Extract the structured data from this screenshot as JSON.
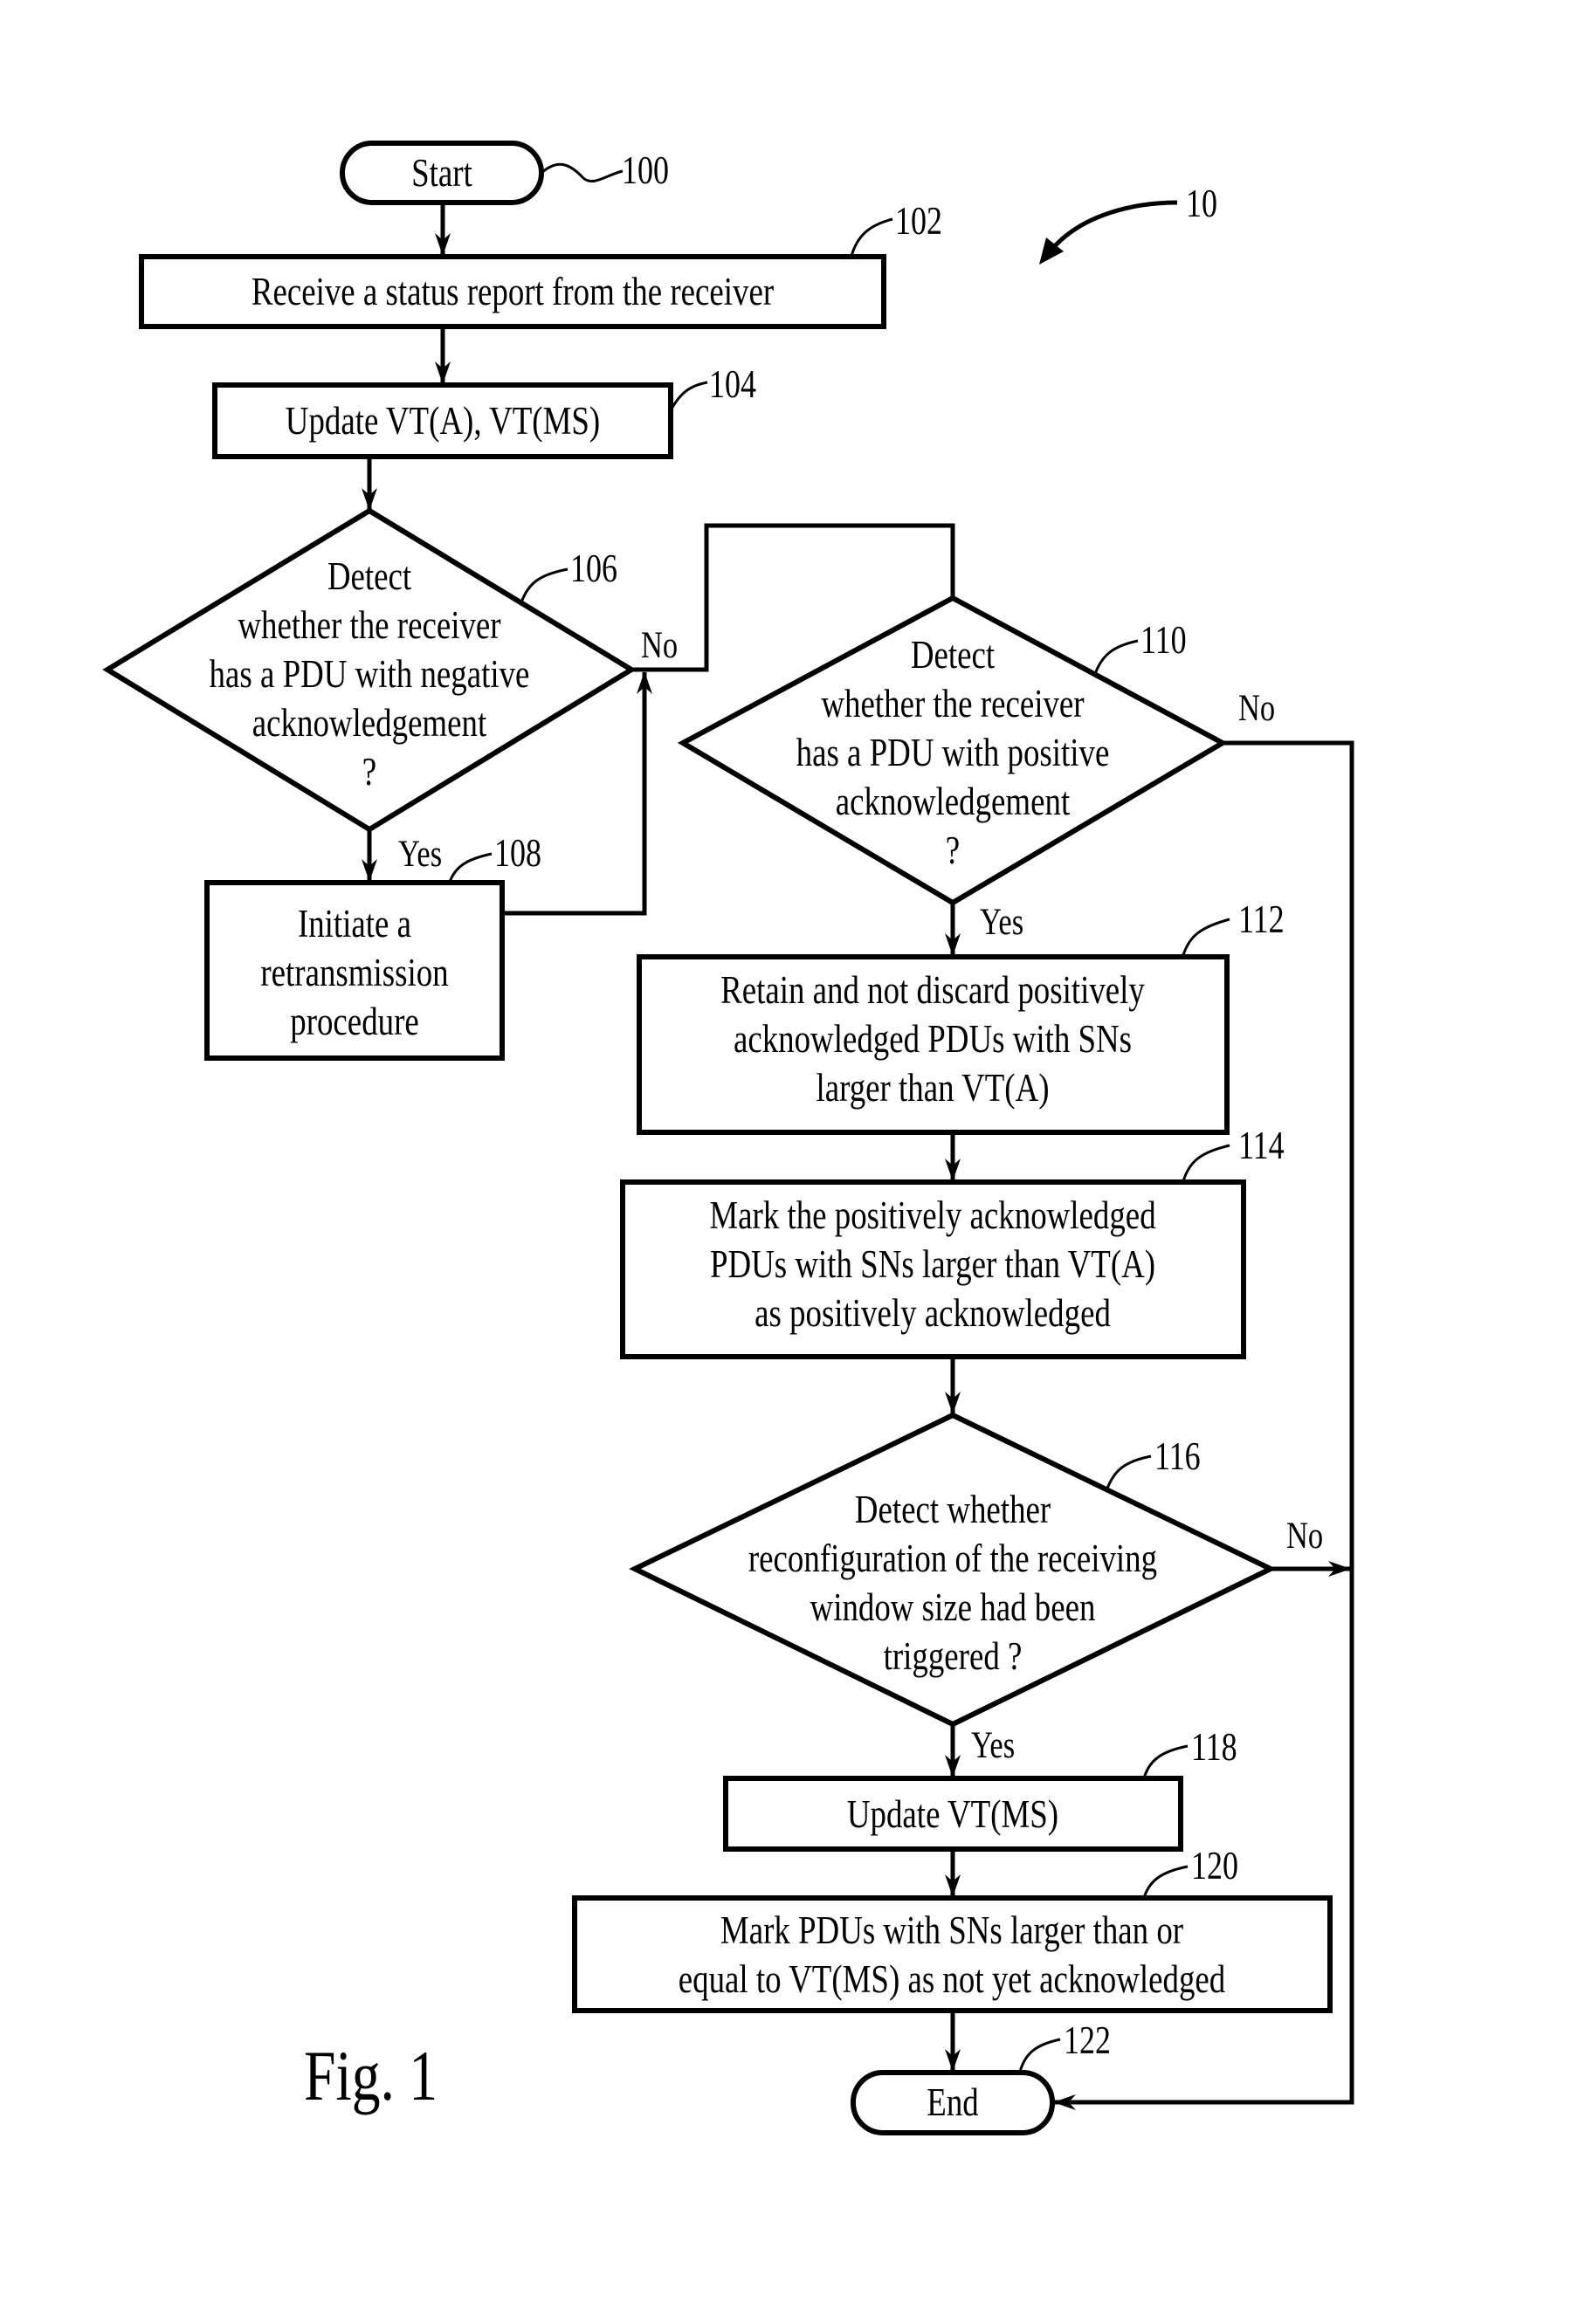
{
  "figure": {
    "label": "Fig. 1",
    "reference": "10",
    "colors": {
      "ink": "#000000",
      "paper": "#ffffff"
    }
  },
  "nodes": {
    "start": {
      "ref": "100",
      "type": "terminator",
      "lines": [
        "Start"
      ]
    },
    "n102": {
      "ref": "102",
      "type": "process",
      "lines": [
        "Receive a status report from the receiver"
      ]
    },
    "n104": {
      "ref": "104",
      "type": "process",
      "lines": [
        "Update VT(A), VT(MS)"
      ]
    },
    "n106": {
      "ref": "106",
      "type": "decision",
      "lines": [
        "Detect",
        "whether the receiver",
        "has a PDU with negative",
        "acknowledgement",
        "?"
      ]
    },
    "n108": {
      "ref": "108",
      "type": "process",
      "lines": [
        "Initiate a",
        "retransmission",
        "procedure"
      ]
    },
    "n110": {
      "ref": "110",
      "type": "decision",
      "lines": [
        "Detect",
        "whether the receiver",
        "has a PDU with positive",
        "acknowledgement",
        "?"
      ]
    },
    "n112": {
      "ref": "112",
      "type": "process",
      "lines": [
        "Retain and not discard positively",
        "acknowledged PDUs with SNs",
        "larger than VT(A)"
      ]
    },
    "n114": {
      "ref": "114",
      "type": "process",
      "lines": [
        "Mark the positively acknowledged",
        "PDUs with SNs larger than VT(A)",
        "as positively acknowledged"
      ]
    },
    "n116": {
      "ref": "116",
      "type": "decision",
      "lines": [
        "Detect whether",
        "reconfiguration of the receiving",
        "window size had been",
        "triggered ?"
      ]
    },
    "n118": {
      "ref": "118",
      "type": "process",
      "lines": [
        "Update VT(MS)"
      ]
    },
    "n120": {
      "ref": "120",
      "type": "process",
      "lines": [
        "Mark PDUs with SNs larger than or",
        "equal to VT(MS) as not yet acknowledged"
      ]
    },
    "end": {
      "ref": "122",
      "type": "terminator",
      "lines": [
        "End"
      ]
    }
  },
  "branches": {
    "n106_yes": "Yes",
    "n106_no": "No",
    "n110_yes": "Yes",
    "n110_no": "No",
    "n116_yes": "Yes",
    "n116_no": "No"
  }
}
